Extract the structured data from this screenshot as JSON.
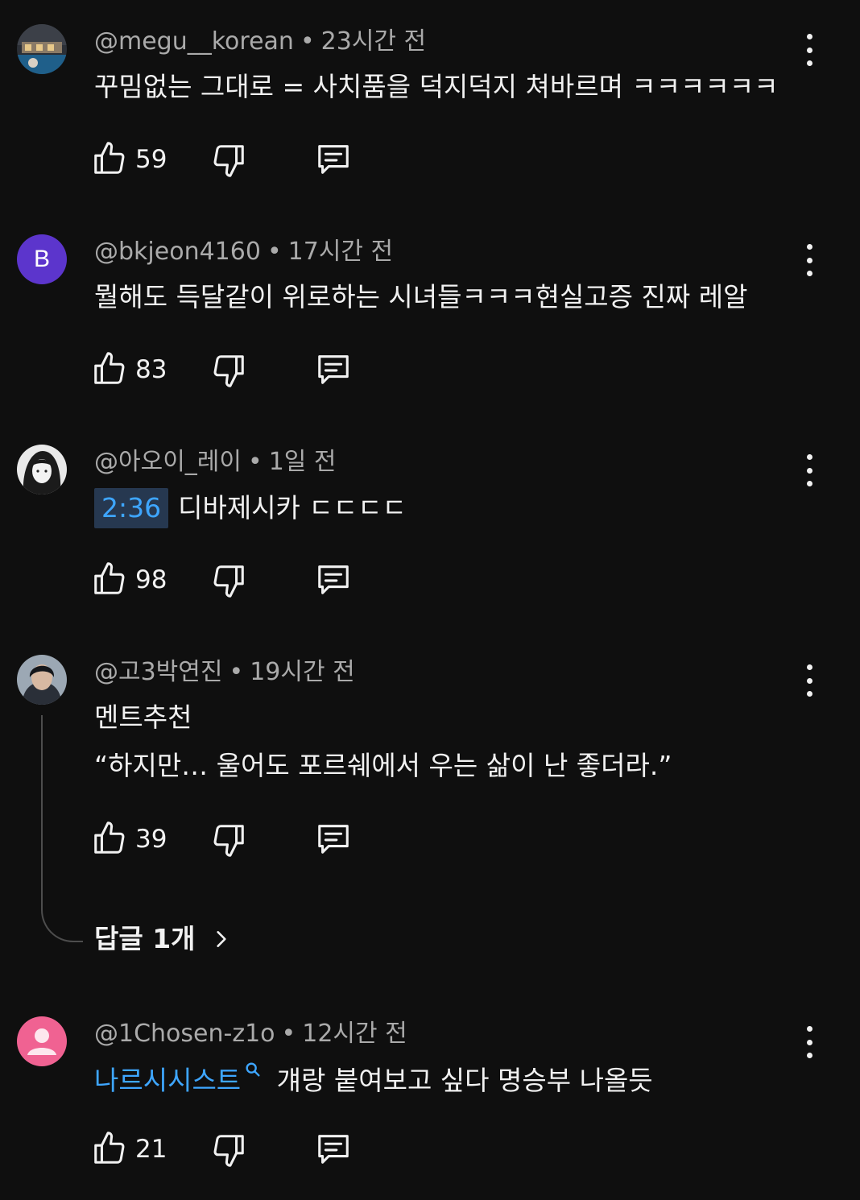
{
  "comments": [
    {
      "author": "@megu__korean",
      "time": "23시간 전",
      "text": "꾸밈없는 그대로 = 사치품을 덕지덕지 쳐바르며 ㅋㅋㅋㅋㅋㅋ",
      "likes": "59"
    },
    {
      "author": "@bkjeon4160",
      "time": "17시간 전",
      "avatar_letter": "B",
      "avatar_color": "#5c35cc",
      "text": "뭘해도 득달같이 위로하는 시녀들ㅋㅋㅋ현실고증 진짜 레알",
      "likes": "83"
    },
    {
      "author": "@아오이_레이",
      "time": "1일 전",
      "timestamp": "2:36",
      "text": "디바제시카 ㄷㄷㄷㄷ",
      "likes": "98"
    },
    {
      "author": "@고3박연진",
      "time": "19시간 전",
      "text_line1": "멘트추천",
      "text_line2": "“하지만… 울어도 포르쉐에서 우는 삶이 난 좋더라.”",
      "likes": "39",
      "replies_label": "답글 1개"
    },
    {
      "author": "@1Chosen-z1o",
      "time": "12시간 전",
      "avatar_color": "#f06292",
      "link_text": "나르시시스트",
      "text": "걔랑 붙여보고 싶다 명승부 나올듯",
      "likes": "21"
    }
  ],
  "separator": "•",
  "accent_color": "#3ea6ff",
  "icons": [
    "thumb-up-icon",
    "thumb-down-icon",
    "reply-icon",
    "more-vert-icon",
    "chevron-right-icon",
    "search-icon"
  ]
}
